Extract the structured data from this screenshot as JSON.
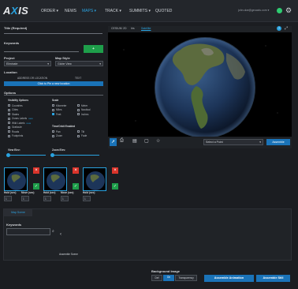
{
  "app": {
    "logo_a": "A",
    "logo_x": "X",
    "logo_rest": "IS"
  },
  "nav": [
    {
      "label": "ORDER ▾"
    },
    {
      "label": "NEWS"
    },
    {
      "label": "MAPS ▾"
    },
    {
      "label": "TRACK ▾"
    },
    {
      "label": "SUMMITS ▾"
    },
    {
      "label": "QUOTED"
    }
  ],
  "user": {
    "email": "john.doe@geoaxis.com ▾"
  },
  "form": {
    "title_label": "Title (Required)",
    "keywords_label": "Keywords",
    "add_label": "+",
    "project_label": "Project",
    "project_value": "Eliminate",
    "mapstyle_label": "Map Style",
    "mapstyle_value": "Globe View",
    "location_label": "Location",
    "address_option": "ADDRESS OR LOCATION",
    "text_option": "TEXT",
    "location_banner": "Click to Pin a new location",
    "options_label": "Options",
    "visibility_label": "Visibility Options",
    "visibility_items": [
      "Countries",
      "Cities",
      "States",
      "Zones Labels",
      "Wild Labels",
      "Graticule",
      "Roads",
      "Footprints"
    ],
    "visibility_badges": [
      "",
      "",
      "",
      "new",
      "new",
      "",
      "",
      ""
    ],
    "scale_label": "Scale",
    "scale_items": [
      "Kilometer",
      "Meter",
      "Miles",
      "Nautical",
      "Feet",
      "Inches"
    ],
    "orbit_label": "Time/Orbit Enabled",
    "orbit_items": [
      "Pan",
      "Tilt",
      "Zoom",
      "Fade"
    ],
    "viewelev_label": "View Elev:",
    "viewelev_value": "",
    "zoomelev_label": "Zoom Elev:",
    "zoomelev_value": ""
  },
  "frames": {
    "items": [
      {
        "labels": [
          "Hold (sec)",
          "Move (sec)"
        ],
        "values": [
          "1",
          "1"
        ]
      },
      {
        "labels": [
          "Hold (sec)",
          "Move (sec)"
        ],
        "values": [
          "1",
          "1"
        ]
      },
      {
        "labels": [
          "Hold (sec)"
        ],
        "values": [
          "1"
        ]
      }
    ],
    "close_icon": "×",
    "confirm_icon": "✓"
  },
  "map": {
    "tabs": [
      "CESIUM",
      "2D",
      "Iris",
      "Satellite"
    ],
    "active_tab": 3,
    "toolbar_icons": [
      "pointer-icon",
      "print-icon",
      "book-icon",
      "bookmark-icon",
      "star-icon"
    ],
    "selection_value": "Select a Point",
    "assemble_label": "Assemble",
    "help_icon": "?",
    "expand_icon": "⤢"
  },
  "bottom": {
    "section_tab": "Map Scene",
    "keywords_label": "Keywords",
    "search_placeholder": "",
    "assemble_scene": "Assemble Scene",
    "background_label": "Background Image",
    "bg_options": [
      "Def",
      "On",
      "Transparency"
    ],
    "assemble_animation": "Assemble Animation",
    "assemble_still": "Assemble Still"
  }
}
